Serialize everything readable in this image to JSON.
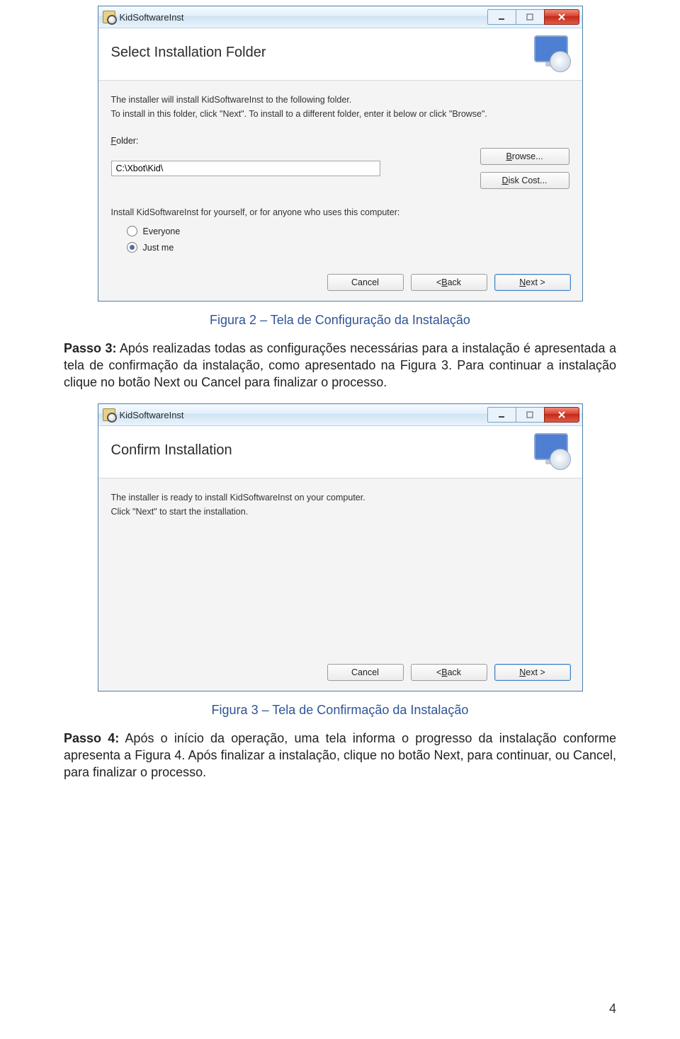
{
  "doc": {
    "caption1": "Figura 2 – Tela de Configuração da Instalação",
    "step3_label": "Passo 3:",
    "step3_text": " Após realizadas todas as configurações necessárias para a instalação é apresentada a tela de confirmação da instalação, como apresentado na Figura 3. Para continuar a instalação clique no botão Next ou Cancel para finalizar o processo.",
    "caption2": "Figura 3 – Tela de Confirmação da Instalação",
    "step4_label": "Passo 4:",
    "step4_text": " Após o início da operação, uma tela informa o progresso da instalação conforme apresenta a Figura 4. Após finalizar a instalação, clique no botão Next, para continuar, ou Cancel, para finalizar o processo.",
    "page_number": "4"
  },
  "dialog1": {
    "title": "KidSoftwareInst",
    "headline": "Select Installation Folder",
    "desc1": "The installer will install KidSoftwareInst to the following folder.",
    "desc2": "To install in this folder, click \"Next\". To install to a different folder, enter it below or click \"Browse\".",
    "folder_label_prefix": "F",
    "folder_label_rest": "older:",
    "folder_value": "C:\\Xbot\\Kid\\",
    "browse_prefix": "B",
    "browse_rest": "rowse...",
    "disk_prefix": "D",
    "disk_rest": "isk Cost...",
    "install_for": "Install KidSoftwareInst for yourself, or for anyone who uses this computer:",
    "radio_everyone_prefix": "E",
    "radio_everyone_rest": "veryone",
    "radio_justme_prefix": "Just ",
    "radio_justme_u": "m",
    "radio_justme_suffix": "e",
    "cancel": "Cancel",
    "back_prefix": "< ",
    "back_u": "B",
    "back_rest": "ack",
    "next_prefix": "",
    "next_u": "N",
    "next_rest": "ext >"
  },
  "dialog2": {
    "title": "KidSoftwareInst",
    "headline": "Confirm Installation",
    "desc1": "The installer is ready to install KidSoftwareInst on your computer.",
    "desc2": "Click \"Next\" to start the installation.",
    "cancel": "Cancel",
    "back_prefix": "< ",
    "back_u": "B",
    "back_rest": "ack",
    "next_u": "N",
    "next_rest": "ext >"
  }
}
